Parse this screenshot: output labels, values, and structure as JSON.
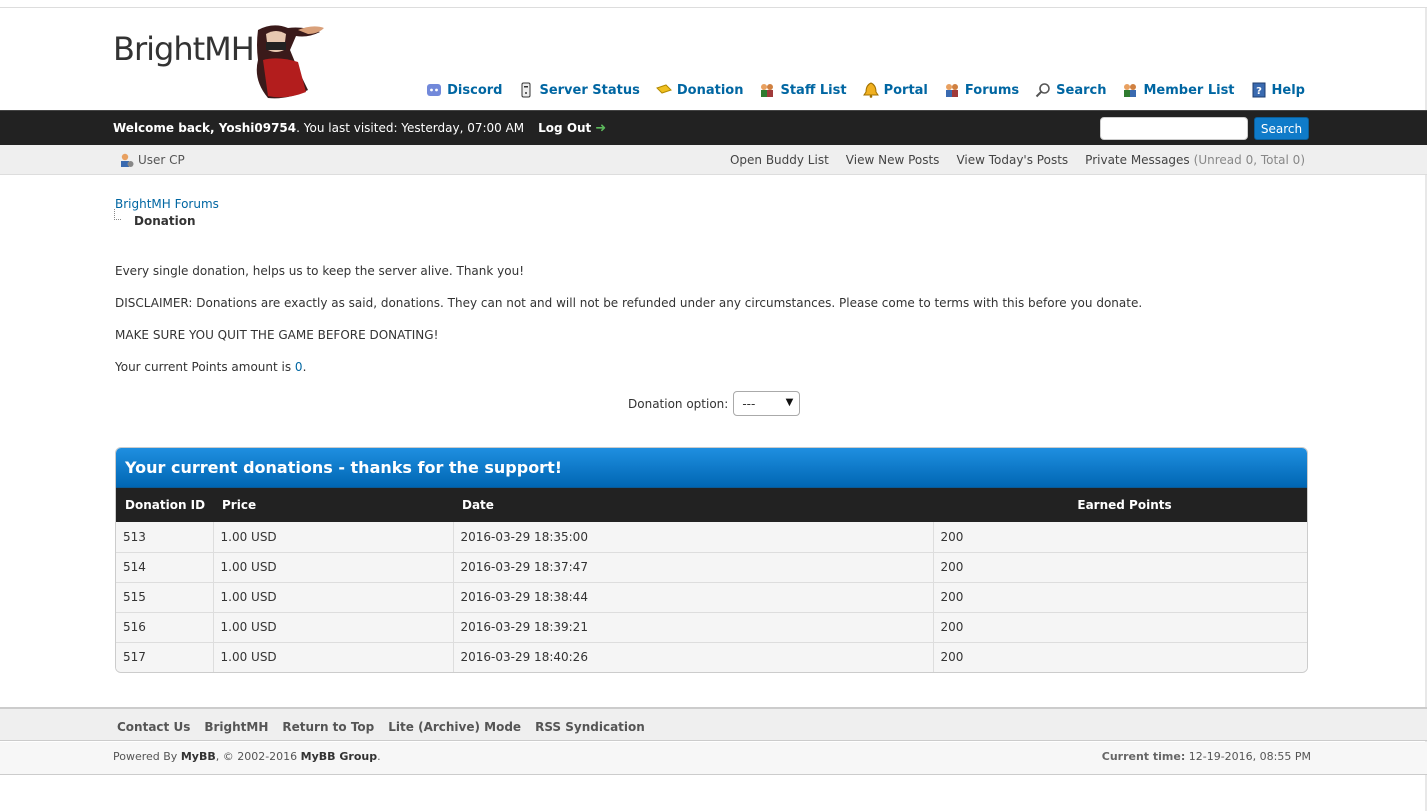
{
  "logo": {
    "text": "BrightMH"
  },
  "menu": [
    {
      "label": "Discord",
      "icon": "discord-icon"
    },
    {
      "label": "Server Status",
      "icon": "server-icon"
    },
    {
      "label": "Donation",
      "icon": "donation-icon"
    },
    {
      "label": "Staff List",
      "icon": "staff-icon"
    },
    {
      "label": "Portal",
      "icon": "bell-icon"
    },
    {
      "label": "Forums",
      "icon": "forums-icon"
    },
    {
      "label": "Search",
      "icon": "search-icon"
    },
    {
      "label": "Member List",
      "icon": "members-icon"
    },
    {
      "label": "Help",
      "icon": "help-icon"
    }
  ],
  "welcome": {
    "greeting": "Welcome back, Yoshi09754",
    "last_visit": ". You last visited: Yesterday, 07:00 AM",
    "logout": "Log Out",
    "search_button": "Search",
    "search_value": ""
  },
  "subbar": {
    "usercp": "User CP",
    "links": [
      "Open Buddy List",
      "View New Posts",
      "View Today's Posts",
      "Private Messages"
    ],
    "pm_count": "(Unread 0, Total 0)"
  },
  "breadcrumb": {
    "forum": "BrightMH Forums",
    "current": "Donation"
  },
  "content": {
    "p1": "Every single donation, helps us to keep the server alive. Thank you!",
    "p2": "DISCLAIMER: Donations are exactly as said, donations. They can not and will not be refunded under any circumstances. Please come to terms with this before you donate.",
    "p3": "MAKE SURE YOU QUIT THE GAME BEFORE DONATING!",
    "p4_prefix": "Your current Points amount is ",
    "points": "0",
    "p4_suffix": ".",
    "donation_option_label": "Donation option:",
    "donation_option_value": "---"
  },
  "donations": {
    "title": "Your current donations - thanks for the support!",
    "headers": [
      "Donation ID",
      "Price",
      "Date",
      "Earned Points"
    ],
    "rows": [
      [
        "513",
        "1.00 USD",
        "2016-03-29 18:35:00",
        "200"
      ],
      [
        "514",
        "1.00 USD",
        "2016-03-29 18:37:47",
        "200"
      ],
      [
        "515",
        "1.00 USD",
        "2016-03-29 18:38:44",
        "200"
      ],
      [
        "516",
        "1.00 USD",
        "2016-03-29 18:39:21",
        "200"
      ],
      [
        "517",
        "1.00 USD",
        "2016-03-29 18:40:26",
        "200"
      ]
    ]
  },
  "footer": {
    "links": [
      "Contact Us",
      "BrightMH",
      "Return to Top",
      "Lite (Archive) Mode",
      "RSS Syndication"
    ],
    "powered_prefix": "Powered By ",
    "powered_brand": "MyBB",
    "powered_mid": ", © 2002-2016 ",
    "powered_group": "MyBB Group",
    "powered_end": ".",
    "current_time_label": "Current time:",
    "current_time_value": " 12-19-2016, 08:55 PM"
  }
}
